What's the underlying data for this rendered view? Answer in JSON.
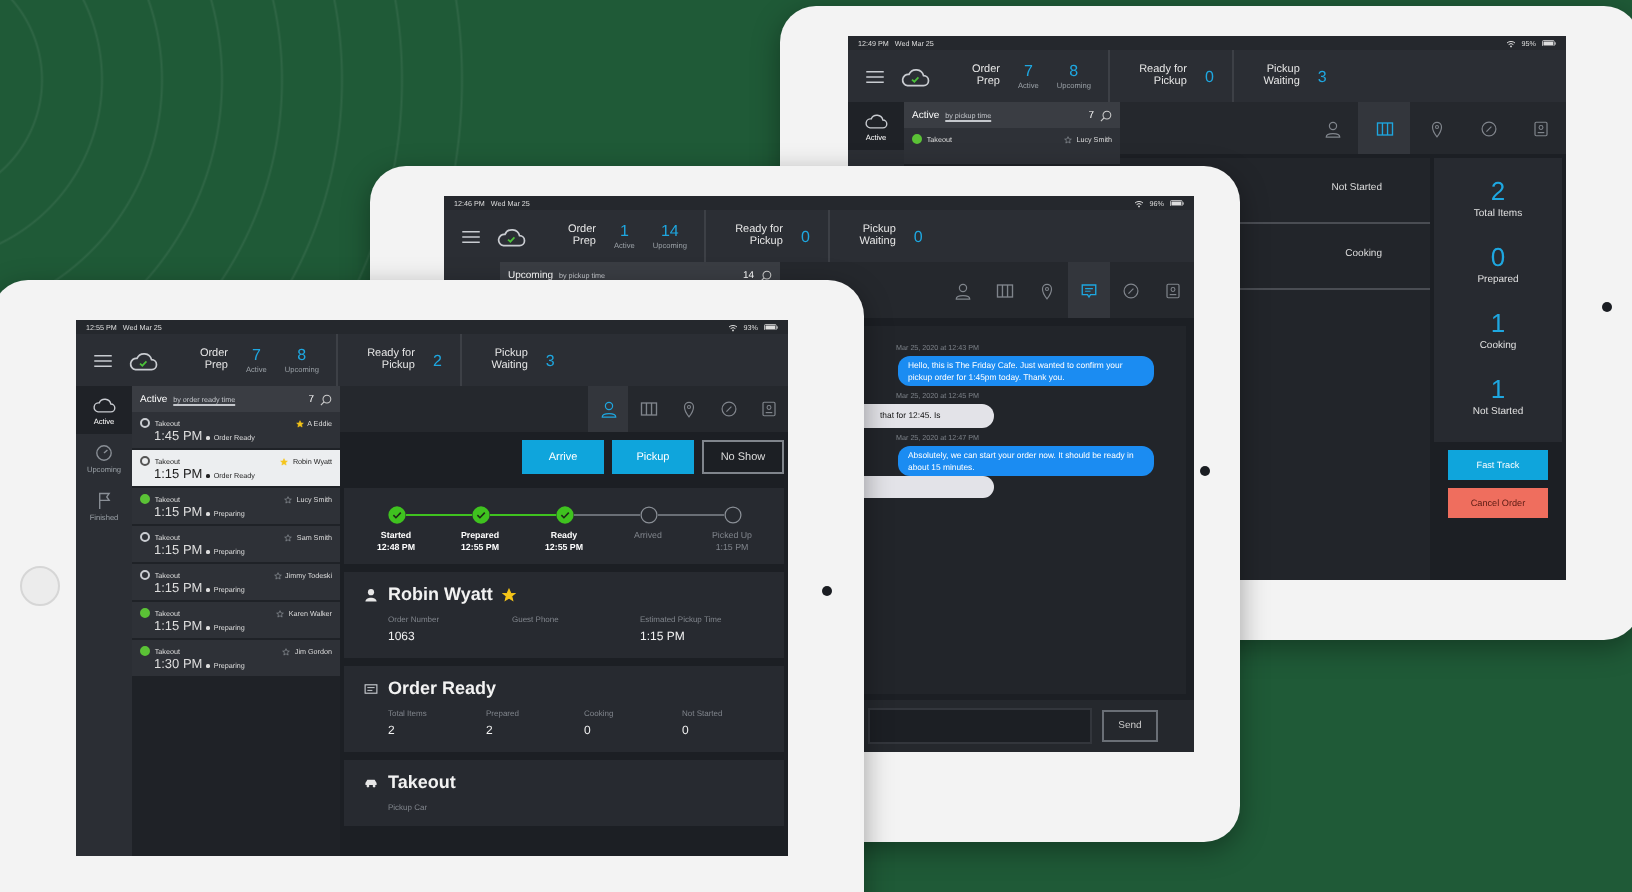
{
  "back_tablet": {
    "status_bar": {
      "time": "12:49 PM",
      "date": "Wed Mar 25",
      "battery": "95%"
    },
    "header": {
      "groups": [
        {
          "label": "Order Prep",
          "counts": [
            {
              "value": "7",
              "label": "Active"
            },
            {
              "value": "8",
              "label": "Upcoming"
            }
          ]
        },
        {
          "label": "Ready for Pickup",
          "counts": [
            {
              "value": "0"
            }
          ]
        },
        {
          "label": "Pickup Waiting",
          "counts": [
            {
              "value": "3"
            }
          ]
        }
      ]
    },
    "side_nav": [
      {
        "label": "Active",
        "selected": true
      }
    ],
    "order_list": {
      "title": "Active",
      "sort": "by pickup time",
      "count": "7",
      "items": [
        {
          "type": "Takeout",
          "name": "Lucy Smith",
          "filled": true,
          "starred": false,
          "selected": false
        }
      ]
    },
    "tabs": [
      {
        "selected": false
      },
      {
        "selected": true
      },
      {
        "selected": false
      },
      {
        "selected": false
      },
      {
        "selected": false
      }
    ],
    "item_statuses": [
      "Not Started",
      "Cooking"
    ],
    "summary": [
      {
        "value": "2",
        "label": "Total Items"
      },
      {
        "value": "0",
        "label": "Prepared"
      },
      {
        "value": "1",
        "label": "Cooking"
      },
      {
        "value": "1",
        "label": "Not Started"
      }
    ],
    "actions": [
      {
        "label": "Fast Track",
        "kind": "primary"
      },
      {
        "label": "Cancel Order",
        "kind": "danger"
      }
    ]
  },
  "middle_tablet": {
    "status_bar": {
      "time": "12:46 PM",
      "date": "Wed Mar 25",
      "battery": "96%"
    },
    "header": {
      "groups": [
        {
          "label": "Order Prep",
          "counts": [
            {
              "value": "1",
              "label": "Active"
            },
            {
              "value": "14",
              "label": "Upcoming"
            }
          ]
        },
        {
          "label": "Ready for Pickup",
          "counts": [
            {
              "value": "0"
            }
          ]
        },
        {
          "label": "Pickup Waiting",
          "counts": [
            {
              "value": "0"
            }
          ]
        }
      ]
    },
    "order_list": {
      "title": "Upcoming",
      "sort": "by pickup time",
      "count": "14"
    },
    "tabs": [
      {
        "selected": false
      },
      {
        "selected": false
      },
      {
        "selected": false
      },
      {
        "selected": true
      },
      {
        "selected": false
      },
      {
        "selected": false
      }
    ],
    "messages": [
      {
        "kind": "timestamp",
        "text": "Mar 25, 2020 at 12:43 PM"
      },
      {
        "kind": "outgoing",
        "text": "Hello, this is The Friday Cafe. Just wanted to confirm your pickup order for 1:45pm today. Thank you."
      },
      {
        "kind": "timestamp",
        "text": "Mar 25, 2020 at 12:45 PM"
      },
      {
        "kind": "incoming",
        "text": "that for 12:45. Is"
      },
      {
        "kind": "timestamp",
        "text": "Mar 25, 2020 at 12:47 PM"
      },
      {
        "kind": "outgoing",
        "text": "Absolutely, we can start your order now. It should be ready in about 15 minutes."
      },
      {
        "kind": "incoming"
      }
    ],
    "send_button": "Send"
  },
  "front_tablet": {
    "status_bar": {
      "time": "12:55 PM",
      "date": "Wed Mar 25",
      "battery": "93%"
    },
    "header": {
      "groups": [
        {
          "label": "Order Prep",
          "counts": [
            {
              "value": "7",
              "label": "Active"
            },
            {
              "value": "8",
              "label": "Upcoming"
            }
          ]
        },
        {
          "label": "Ready for Pickup",
          "counts": [
            {
              "value": "2"
            }
          ]
        },
        {
          "label": "Pickup Waiting",
          "counts": [
            {
              "value": "3"
            }
          ]
        }
      ]
    },
    "side_nav": [
      {
        "label": "Active",
        "selected": true
      },
      {
        "label": "Upcoming",
        "selected": false
      },
      {
        "label": "Finished",
        "selected": false
      }
    ],
    "order_list": {
      "title": "Active",
      "sort": "by order ready time",
      "count": "7",
      "items": [
        {
          "type": "Takeout",
          "name": "A Eddie",
          "time": "1:45 PM",
          "status": "Order Ready",
          "filled": false,
          "starred": true,
          "selected": false
        },
        {
          "type": "Takeout",
          "name": "Robin Wyatt",
          "time": "1:15 PM",
          "status": "Order Ready",
          "filled": false,
          "starred": true,
          "selected": true
        },
        {
          "type": "Takeout",
          "name": "Lucy Smith",
          "time": "1:15 PM",
          "status": "Preparing",
          "filled": true,
          "starred": false,
          "selected": false
        },
        {
          "type": "Takeout",
          "name": "Sam Smith",
          "time": "1:15 PM",
          "status": "Preparing",
          "filled": false,
          "starred": false,
          "selected": false
        },
        {
          "type": "Takeout",
          "name": "Jimmy Todeski",
          "time": "1:15 PM",
          "status": "Preparing",
          "filled": false,
          "starred": false,
          "selected": false
        },
        {
          "type": "Takeout",
          "name": "Karen Walker",
          "time": "1:15 PM",
          "status": "Preparing",
          "filled": true,
          "starred": false,
          "selected": false
        },
        {
          "type": "Takeout",
          "name": "Jim Gordon",
          "time": "1:30 PM",
          "status": "Preparing",
          "filled": true,
          "starred": false,
          "selected": false
        }
      ]
    },
    "tabs": [
      {
        "selected": true
      },
      {
        "selected": false
      },
      {
        "selected": false
      },
      {
        "selected": false
      },
      {
        "selected": false
      }
    ],
    "actions": [
      {
        "label": "Arrive",
        "kind": "primary"
      },
      {
        "label": "Pickup",
        "kind": "primary"
      },
      {
        "label": "No Show",
        "kind": "outline"
      }
    ],
    "progress": [
      {
        "label": "Started",
        "time": "12:48 PM",
        "done": true
      },
      {
        "label": "Prepared",
        "time": "12:55 PM",
        "done": true
      },
      {
        "label": "Ready",
        "time": "12:55 PM",
        "done": true
      },
      {
        "label": "Arrived",
        "done": false
      },
      {
        "label": "Picked Up",
        "time": "1:15 PM",
        "done": false
      }
    ],
    "customer": {
      "name": "Robin Wyatt",
      "starred": true,
      "fields": [
        {
          "label": "Order Number",
          "value": "1063"
        },
        {
          "label": "Guest Phone"
        },
        {
          "label": "Estimated Pickup Time",
          "value": "1:15 PM"
        }
      ]
    },
    "order_status": {
      "title": "Order Ready",
      "stats": [
        {
          "label": "Total Items",
          "value": "2"
        },
        {
          "label": "Prepared",
          "value": "2"
        },
        {
          "label": "Cooking",
          "value": "0"
        },
        {
          "label": "Not Started",
          "value": "0"
        }
      ]
    },
    "fulfillment": {
      "title": "Takeout",
      "fields": [
        {
          "label": "Pickup Car"
        }
      ]
    }
  }
}
